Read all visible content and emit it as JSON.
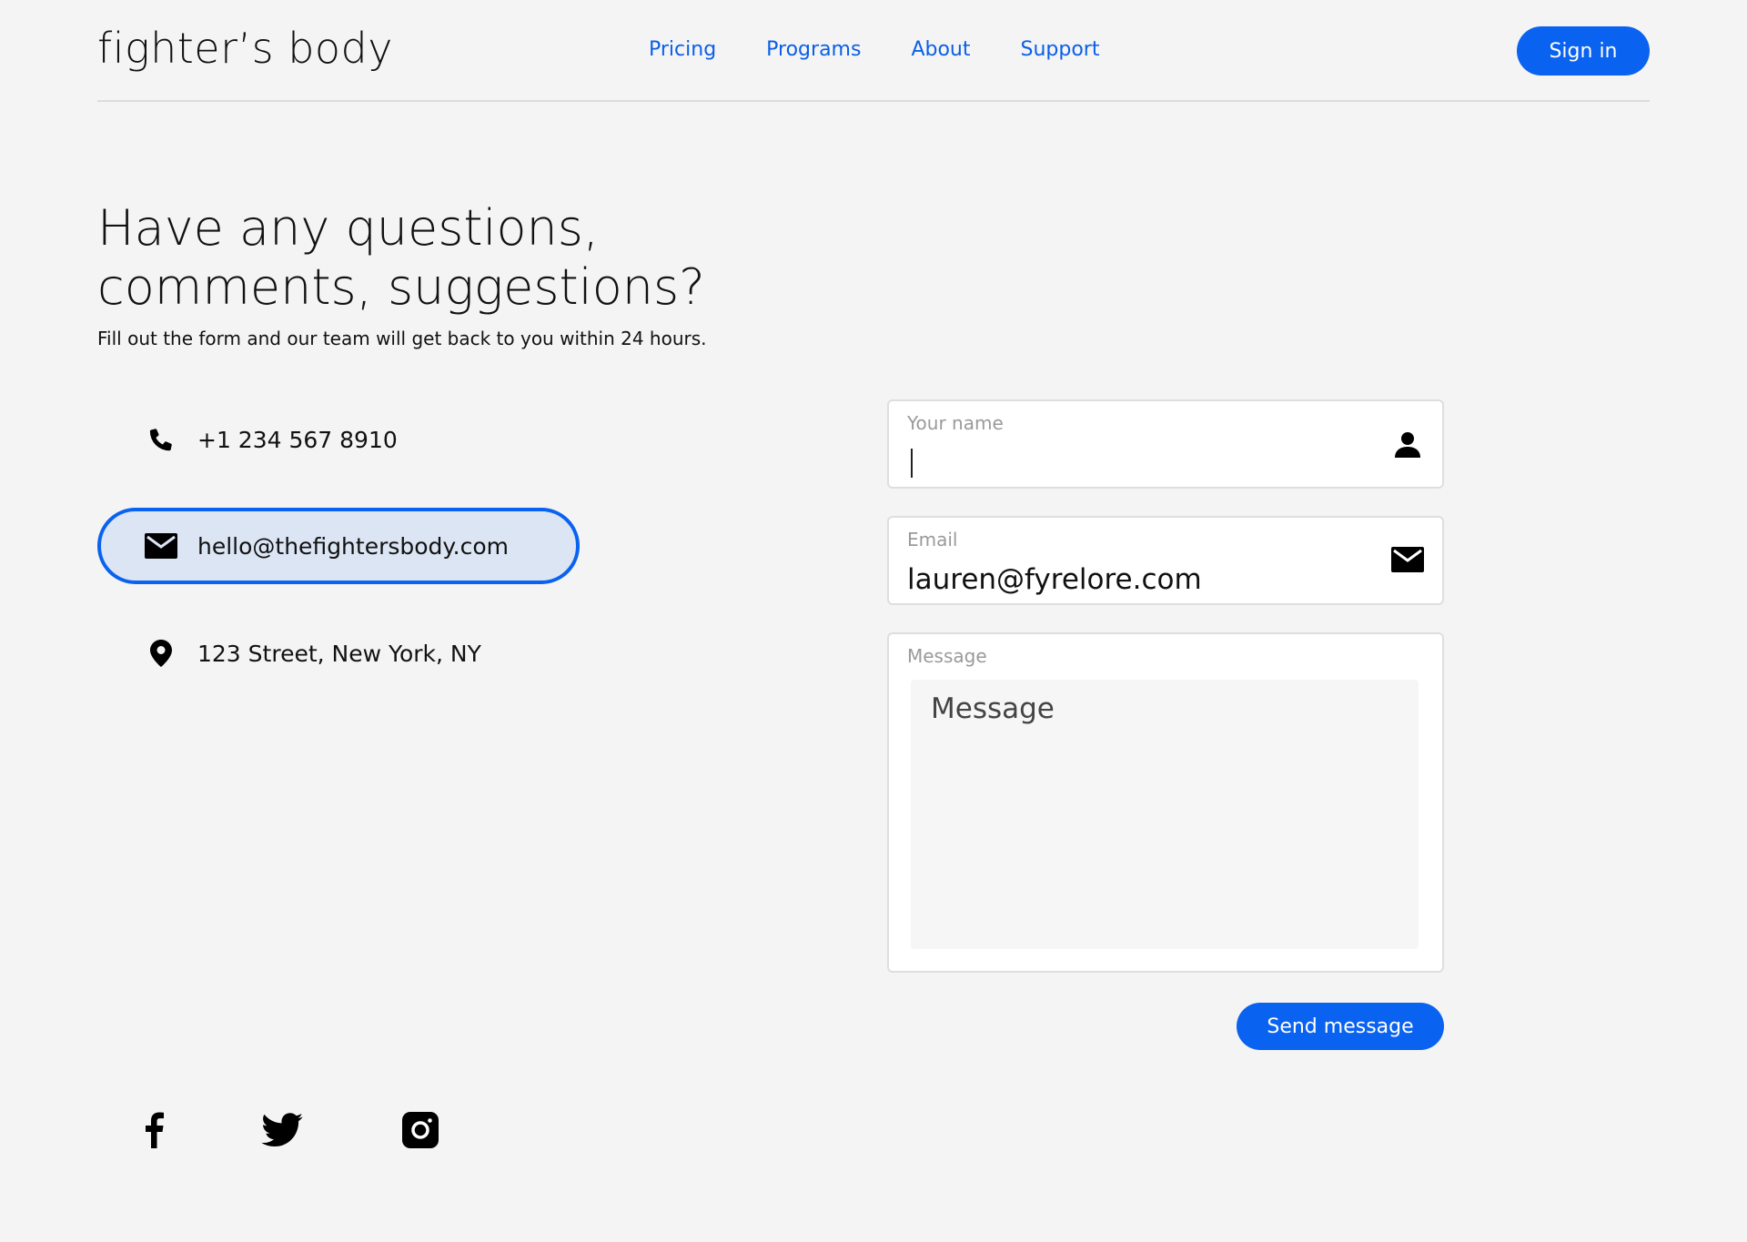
{
  "brand": {
    "logo": "fighter’s body"
  },
  "nav": {
    "items": [
      "Pricing",
      "Programs",
      "About",
      "Support"
    ],
    "signin_label": "Sign in"
  },
  "hero": {
    "headline_line1": "Have any questions,",
    "headline_line2": "comments, suggestions?",
    "subline": "Fill out the form and our team will get back to you within 24 hours."
  },
  "contact": {
    "phone": "+1 234 567 8910",
    "email": "hello@thefightersbody.com",
    "address": "123 Street, New York, NY"
  },
  "form": {
    "name_label": "Your name",
    "name_value": "",
    "email_label": "Email",
    "email_value": "lauren@fyrelore.com",
    "message_label": "Message",
    "message_placeholder": "Message",
    "send_label": "Send message"
  },
  "social": [
    "facebook-icon",
    "twitter-icon",
    "instagram-icon"
  ],
  "colors": {
    "accent": "#0a62f0",
    "active_bg": "#dbe5f4"
  }
}
